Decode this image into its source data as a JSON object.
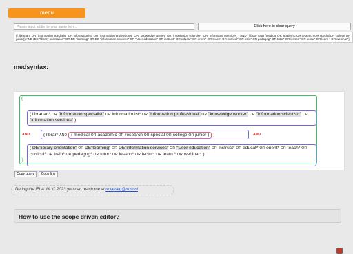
{
  "menu": {
    "label": "menu"
  },
  "query_title": {
    "placeholder": "Please input a title for your query here..."
  },
  "clear_button": {
    "label": "Click here to clear query"
  },
  "query_text": "(( librarian* OR \"information specialist\" OR informationist* OR \"information professional\" OR \"knowledge worker\" OR \"information scientist*\" OR \"information services\" ) AND ( librar* AND (medical OR academic OR research OR special OR college OR junior)) AND (DE \"library orientation\" OR DE \"learning\" OR DE \"information services\" OR \"User education\" OR instruct* OR educat* OR orient* OR teach* OR curricul* OR train* OR pedagog* OR tutor* OR lesson* OR lectur* OR learn * OR webinar*))",
  "section_title": "medsyntax:",
  "editor": {
    "open_paren": "(",
    "close_paren": ")",
    "group1": {
      "open": "( ",
      "close": " )",
      "tokens": [
        {
          "text": "librarian*",
          "hl": false
        },
        {
          "op": "OR"
        },
        {
          "text": "\"information specialist\"",
          "hl": true
        },
        {
          "op": "OR"
        },
        {
          "text": "informationist*",
          "hl": false
        },
        {
          "op": "OR"
        },
        {
          "text": "\"information professional\"",
          "hl": true
        },
        {
          "op": "OR"
        },
        {
          "text": "\"knowledge worker\"",
          "hl": true
        },
        {
          "op": "OR"
        },
        {
          "text": "\"information scientist*\"",
          "hl": true
        },
        {
          "op": "OR"
        },
        {
          "text": "\"information services\"",
          "hl": true
        }
      ]
    },
    "and1": "AND",
    "group2": {
      "open": "( ",
      "close": " )",
      "term": "librar*",
      "and_label": "AND",
      "inner_tokens": [
        {
          "text": "medical",
          "hl": false
        },
        {
          "op": "OR"
        },
        {
          "text": "academic",
          "hl": false
        },
        {
          "op": "OR"
        },
        {
          "text": "research",
          "hl": false
        },
        {
          "op": "OR"
        },
        {
          "text": "special",
          "hl": false
        },
        {
          "op": "OR"
        },
        {
          "text": "college",
          "hl": false
        },
        {
          "op": "OR"
        },
        {
          "text": "junior",
          "hl": false
        }
      ]
    },
    "and2": "AND",
    "group3": {
      "open": "( ",
      "close": " )",
      "tokens": [
        {
          "text": "DE\"library orientation\"",
          "hl": true
        },
        {
          "op": "OR"
        },
        {
          "text": "DE\"learning\"",
          "hl": true
        },
        {
          "op": "OR"
        },
        {
          "text": "DE\"information services\"",
          "hl": true
        },
        {
          "op": "OR"
        },
        {
          "text": "\"User education\"",
          "hl": true
        },
        {
          "op": "OR"
        },
        {
          "text": "instruct*",
          "hl": false
        },
        {
          "op": "OR"
        },
        {
          "text": "educat*",
          "hl": false
        },
        {
          "op": "OR"
        },
        {
          "text": "orient*",
          "hl": false
        },
        {
          "op": "OR"
        },
        {
          "text": "teach*",
          "hl": false
        },
        {
          "op": "OR"
        },
        {
          "text": "curricul*",
          "hl": false
        },
        {
          "op": "OR"
        },
        {
          "text": "train*",
          "hl": false
        },
        {
          "op": "OR"
        },
        {
          "text": "pedagog*",
          "hl": false
        },
        {
          "op": "OR"
        },
        {
          "text": "tutor*",
          "hl": false
        },
        {
          "op": "OR"
        },
        {
          "text": "lesson*",
          "hl": false
        },
        {
          "op": "OR"
        },
        {
          "text": "lectur*",
          "hl": false
        },
        {
          "op": "OR"
        },
        {
          "text": "learn *",
          "hl": false
        },
        {
          "op": "OR"
        },
        {
          "text": "webinar*",
          "hl": false
        }
      ]
    }
  },
  "buttons": {
    "copy_query": "Copy query",
    "copy_link": "Copy link"
  },
  "ifla": {
    "text": "During the IFLA WLIC 2023 you can reach me at ",
    "email": "m.verleg@mzh.nl"
  },
  "howto": {
    "title": "How to use the scope driven editor?"
  },
  "colors": {
    "accent": "#f7941d",
    "outer_border": "#3fbf5f",
    "group_border": "#6f6ae0",
    "inner_border": "#e06a6a",
    "and_color": "#cc2b2b",
    "delete": "#c0392b"
  },
  "icons": {
    "delete": "delete-square-icon"
  }
}
